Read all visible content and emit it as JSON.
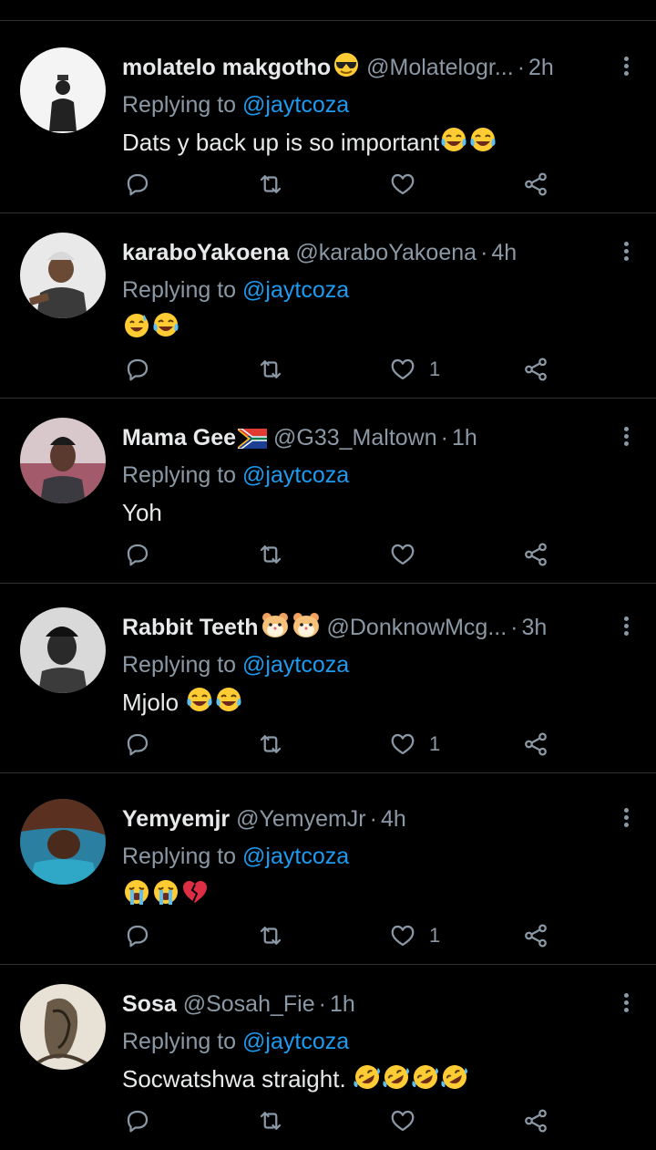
{
  "tweets": [
    {
      "name": "molatelo makgotho",
      "name_emoji": [
        "sunglasses-face"
      ],
      "handle": "@Molatelogr...",
      "time": "2h",
      "replying_prefix": "Replying to",
      "mention": "@jaytcoza",
      "text": "Dats y back up is so important",
      "text_emoji": [
        "tears-of-joy",
        "tears-of-joy"
      ],
      "likes": ""
    },
    {
      "name": "karaboYakoena",
      "name_emoji": [],
      "handle": "@karaboYakoena",
      "time": "4h",
      "replying_prefix": "Replying to",
      "mention": "@jaytcoza",
      "text": "",
      "text_emoji": [
        "grinning-sweat",
        "tears-of-joy"
      ],
      "likes": "1"
    },
    {
      "name": "Mama Gee",
      "name_emoji": [
        "flag-south-africa"
      ],
      "handle": "@G33_Maltown",
      "time": "1h",
      "replying_prefix": "Replying to",
      "mention": "@jaytcoza",
      "text": "Yoh",
      "text_emoji": [],
      "likes": ""
    },
    {
      "name": "Rabbit Teeth",
      "name_emoji": [
        "hamster-face",
        "hamster-face"
      ],
      "handle": "@DonknowMcg...",
      "time": "3h",
      "replying_prefix": "Replying to",
      "mention": "@jaytcoza",
      "text": "Mjolo ",
      "text_emoji": [
        "tears-of-joy",
        "tears-of-joy"
      ],
      "likes": "1"
    },
    {
      "name": "Yemyemjr",
      "name_emoji": [],
      "handle": "@YemyemJr",
      "time": "4h",
      "replying_prefix": "Replying to",
      "mention": "@jaytcoza",
      "text": "",
      "text_emoji": [
        "loudly-crying",
        "loudly-crying",
        "broken-heart"
      ],
      "likes": "1"
    },
    {
      "name": "Sosa",
      "name_emoji": [],
      "handle": "@Sosah_Fie",
      "time": "1h",
      "replying_prefix": "Replying to",
      "mention": "@jaytcoza",
      "text": "Socwatshwa straight. ",
      "text_emoji": [
        "rofl",
        "rofl",
        "rofl",
        "rofl"
      ],
      "likes": ""
    }
  ],
  "colors": {
    "background": "#000000",
    "divider": "#2f3336",
    "primary_text": "#e7e9ea",
    "secondary_text": "#8b98a5",
    "mention": "#1d9bf0"
  },
  "icons": {
    "reply": "reply-icon",
    "retweet": "retweet-icon",
    "like": "like-icon",
    "share": "share-icon",
    "more": "more-icon"
  }
}
